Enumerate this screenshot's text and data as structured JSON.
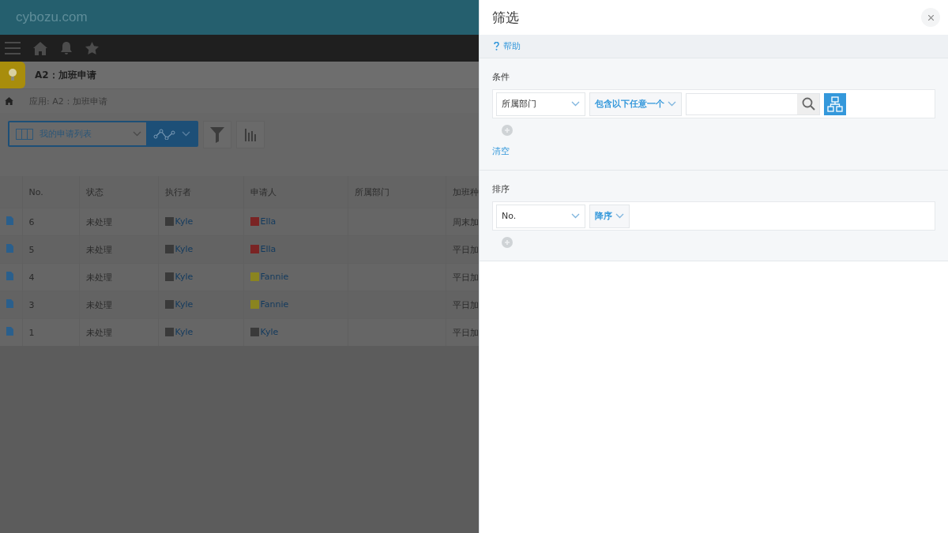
{
  "header": {
    "logo": "cybozu.com"
  },
  "app": {
    "title": "A2：加班申请",
    "breadcrumb": "应用: A2：加班申请"
  },
  "view": {
    "name": "我的申请列表"
  },
  "table": {
    "columns": [
      "No.",
      "状态",
      "执行者",
      "申请人",
      "所属部门",
      "加班种"
    ],
    "rows": [
      {
        "no": "6",
        "status": "未处理",
        "executor": {
          "name": "Kyle",
          "color": "#3a3a3a"
        },
        "applicant": {
          "name": "Ella",
          "color": "#7a2424"
        },
        "department": "",
        "type": "周末加"
      },
      {
        "no": "5",
        "status": "未处理",
        "executor": {
          "name": "Kyle",
          "color": "#3a3a3a"
        },
        "applicant": {
          "name": "Ella",
          "color": "#7a2424"
        },
        "department": "",
        "type": "平日加"
      },
      {
        "no": "4",
        "status": "未处理",
        "executor": {
          "name": "Kyle",
          "color": "#3a3a3a"
        },
        "applicant": {
          "name": "Fannie",
          "color": "#8a8420"
        },
        "department": "",
        "type": "平日加"
      },
      {
        "no": "3",
        "status": "未处理",
        "executor": {
          "name": "Kyle",
          "color": "#3a3a3a"
        },
        "applicant": {
          "name": "Fannie",
          "color": "#8a8420"
        },
        "department": "",
        "type": "平日加"
      },
      {
        "no": "1",
        "status": "未处理",
        "executor": {
          "name": "Kyle",
          "color": "#3a3a3a"
        },
        "applicant": {
          "name": "Kyle",
          "color": "#3a3a3a"
        },
        "department": "",
        "type": "平日加"
      }
    ]
  },
  "filter_panel": {
    "title": "筛选",
    "help": "帮助",
    "conditions": {
      "label": "条件",
      "field": "所属部门",
      "operator": "包含以下任意一个",
      "clear": "清空"
    },
    "sort": {
      "label": "排序",
      "field": "No.",
      "order": "降序"
    }
  }
}
